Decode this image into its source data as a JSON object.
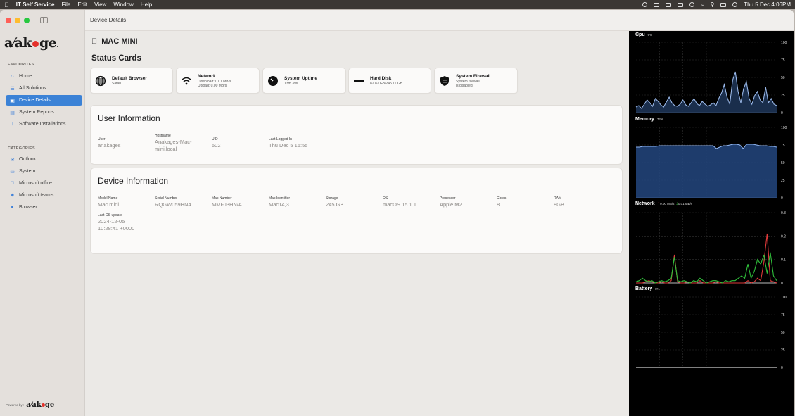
{
  "menubar": {
    "app_name": "IT Self Service",
    "menus": [
      "File",
      "Edit",
      "View",
      "Window",
      "Help"
    ],
    "clock": "Thu 5 Dec  4:06PM"
  },
  "sidebar": {
    "logo_text": "anakage",
    "favourites_label": "FAVOURITES",
    "favourites": [
      {
        "label": "Home",
        "icon": "home-icon"
      },
      {
        "label": "All Solutions",
        "icon": "list-icon"
      },
      {
        "label": "Device Details",
        "icon": "device-icon",
        "active": true
      },
      {
        "label": "System Reports",
        "icon": "report-icon"
      },
      {
        "label": "Software Installations",
        "icon": "download-icon"
      }
    ],
    "categories_label": "CATEGORIES",
    "categories": [
      {
        "label": "Outlook",
        "icon": "mail-icon"
      },
      {
        "label": "System",
        "icon": "monitor-icon"
      },
      {
        "label": "Microsoft office",
        "icon": "document-icon"
      },
      {
        "label": "Microsoft teams",
        "icon": "people-icon"
      },
      {
        "label": "Browser",
        "icon": "globe-icon"
      }
    ],
    "powered_by": "Powered by :"
  },
  "topbar": {
    "title": "Device Details"
  },
  "main": {
    "device_name": "MAC MINI",
    "status_heading": "Status Cards",
    "status_cards": [
      {
        "title": "Default Browser",
        "lines": [
          "Safari"
        ],
        "icon": "globe-icon"
      },
      {
        "title": "Network",
        "lines": [
          "Download: 0.01 MB/s",
          "Upload: 0.00 MB/s"
        ],
        "icon": "wifi-icon"
      },
      {
        "title": "System Uptime",
        "lines": [
          "13m 39s"
        ],
        "icon": "clock-icon"
      },
      {
        "title": "Hard Disk",
        "lines": [
          "82.82 GB/245.11 GB"
        ],
        "icon": "disk-icon"
      },
      {
        "title": "System Firewall",
        "lines": [
          "System firewall",
          "is disabled"
        ],
        "icon": "shield-icon"
      }
    ],
    "user_info": {
      "heading": "User Information",
      "fields": [
        {
          "label": "User",
          "value": "anakages"
        },
        {
          "label": "Hostname",
          "value": "Anakages-Mac-mini.local"
        },
        {
          "label": "UID",
          "value": "502"
        },
        {
          "label": "Last Logged In",
          "value": "Thu Dec 5 15:55"
        }
      ]
    },
    "device_info": {
      "heading": "Device Information",
      "fields": [
        {
          "label": "Model Name",
          "value": "Mac mini"
        },
        {
          "label": "Serial Number",
          "value": "RQGW059HN4"
        },
        {
          "label": "Mac Number",
          "value": "MMFJ3HN/A"
        },
        {
          "label": "Mac Identifier",
          "value": "Mac14,3"
        },
        {
          "label": "Storage",
          "value": "245 GB"
        },
        {
          "label": "OS",
          "value": "macOS 15.1.1"
        },
        {
          "label": "Processor",
          "value": "Apple M2"
        },
        {
          "label": "Cores",
          "value": "8"
        },
        {
          "label": "RAM",
          "value": "8GB"
        }
      ],
      "last_update_label": "Last OS update",
      "last_update_value": "2024-12-05 10:28:41 +0000"
    }
  },
  "stats": {
    "cpu": {
      "title": "Cpu",
      "value": "6%",
      "ticks": [
        "100",
        "75",
        "50",
        "25",
        "0"
      ]
    },
    "memory": {
      "title": "Memory",
      "value": "72%",
      "ticks": [
        "100",
        "75",
        "50",
        "25",
        "0"
      ]
    },
    "network": {
      "title": "Network",
      "upload": "0.00 MB/s",
      "download": "0.01 MB/s",
      "ticks": [
        "0.3",
        "0.2",
        "0.1",
        "0"
      ]
    },
    "battery": {
      "title": "Battery",
      "value": "0%",
      "ticks": [
        "100",
        "75",
        "50",
        "25",
        "0"
      ]
    }
  },
  "colors": {
    "accent": "#3b82d6",
    "logo_dot": "#e4312b",
    "cpu_line": "#9ab8e8",
    "memory_line": "#8fb4ef",
    "network_upload": "#e03a3a",
    "network_download": "#2fbf3a"
  },
  "chart_data": [
    {
      "type": "area",
      "title": "Cpu",
      "ylim": [
        0,
        100
      ],
      "values": [
        8,
        10,
        6,
        12,
        18,
        14,
        9,
        20,
        16,
        11,
        8,
        15,
        22,
        14,
        10,
        9,
        12,
        18,
        11,
        9,
        14,
        20,
        13,
        10,
        16,
        12,
        9,
        11,
        14,
        10,
        20,
        28,
        40,
        22,
        12,
        46,
        58,
        30,
        14,
        34,
        44,
        20,
        12,
        24,
        30,
        18,
        14,
        36,
        14,
        20,
        12,
        10
      ]
    },
    {
      "type": "area",
      "title": "Memory",
      "ylim": [
        0,
        100
      ],
      "values": [
        72,
        72,
        73,
        73,
        73,
        73,
        73,
        74,
        74,
        74,
        74,
        74,
        74,
        74,
        74,
        74,
        74,
        74,
        74,
        74,
        74,
        74,
        74,
        74,
        70,
        72,
        74,
        74,
        75,
        76,
        76,
        75,
        70,
        76,
        76,
        76,
        75,
        74,
        74,
        74,
        73,
        73,
        72
      ]
    },
    {
      "type": "line",
      "title": "Network",
      "ylim": [
        0,
        0.3
      ],
      "series": [
        {
          "values": [
            0,
            0,
            0,
            0.005,
            0.01,
            0.005,
            0,
            0,
            0.005,
            0,
            0,
            0.01,
            0.12,
            0.005,
            0,
            0,
            0.005,
            0,
            0,
            0,
            0.01,
            0,
            0,
            0,
            0,
            0.005,
            0,
            0,
            0,
            0,
            0,
            0,
            0,
            0,
            0,
            0.01,
            0,
            0.005,
            0.02,
            0.01,
            0.09,
            0.21,
            0.01,
            0.005,
            0
          ]
        },
        {
          "values": [
            0.005,
            0.01,
            0.02,
            0.01,
            0.005,
            0.01,
            0,
            0.005,
            0.01,
            0.005,
            0.01,
            0.02,
            0.11,
            0.01,
            0.005,
            0.01,
            0.005,
            0,
            0.01,
            0.005,
            0.02,
            0.01,
            0,
            0.005,
            0.01,
            0.01,
            0.005,
            0,
            0.01,
            0.005,
            0.01,
            0.01,
            0.02,
            0.03,
            0.02,
            0.08,
            0.02,
            0.05,
            0.1,
            0.08,
            0.12,
            0.04,
            0.13,
            0.03,
            0.01
          ]
        }
      ]
    },
    {
      "type": "line",
      "title": "Battery",
      "ylim": [
        0,
        100
      ],
      "values": [
        0,
        0,
        0,
        0,
        0,
        0,
        0,
        0,
        0,
        0
      ]
    }
  ]
}
